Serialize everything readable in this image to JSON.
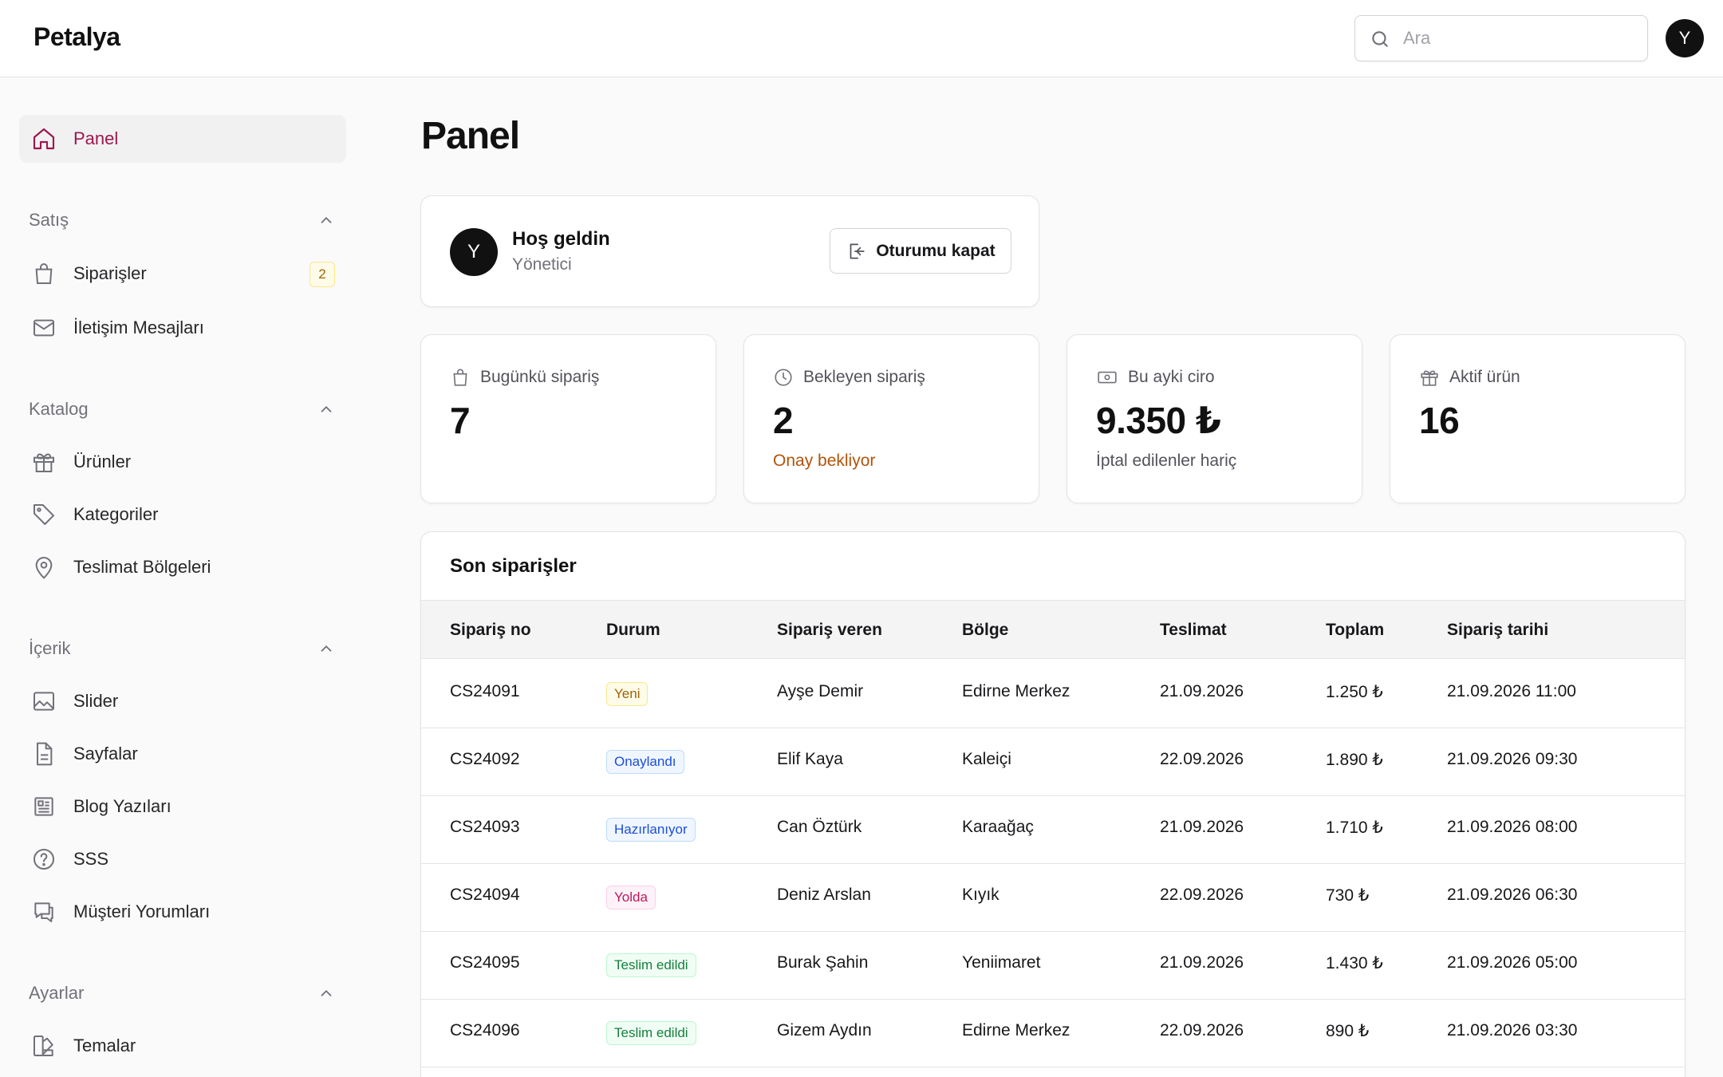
{
  "brand": "Petalya",
  "search": {
    "placeholder": "Ara",
    "value": ""
  },
  "user": {
    "initial": "Y"
  },
  "sidebar": {
    "panel": "Panel",
    "sections": [
      {
        "title": "Satış",
        "items": [
          {
            "label": "Siparişler",
            "icon": "shopping-bag-icon",
            "badge": "2"
          },
          {
            "label": "İletişim Mesajları",
            "icon": "mail-icon"
          }
        ]
      },
      {
        "title": "Katalog",
        "items": [
          {
            "label": "Ürünler",
            "icon": "gift-icon"
          },
          {
            "label": "Kategoriler",
            "icon": "tag-icon"
          },
          {
            "label": "Teslimat Bölgeleri",
            "icon": "map-pin-icon"
          }
        ]
      },
      {
        "title": "İçerik",
        "items": [
          {
            "label": "Slider",
            "icon": "image-icon"
          },
          {
            "label": "Sayfalar",
            "icon": "file-icon"
          },
          {
            "label": "Blog Yazıları",
            "icon": "newspaper-icon"
          },
          {
            "label": "SSS",
            "icon": "help-circle-icon"
          },
          {
            "label": "Müşteri Yorumları",
            "icon": "message-icon"
          }
        ]
      },
      {
        "title": "Ayarlar",
        "items": [
          {
            "label": "Temalar",
            "icon": "palette-icon"
          }
        ]
      }
    ]
  },
  "page_title": "Panel",
  "welcome": {
    "initial": "Y",
    "title": "Hoş geldin",
    "subtitle": "Yönetici",
    "logout": "Oturumu kapat"
  },
  "stats": [
    {
      "label": "Bugünkü sipariş",
      "value": "7",
      "note": "",
      "icon": "shopping-bag-icon"
    },
    {
      "label": "Bekleyen sipariş",
      "value": "2",
      "note": "Onay bekliyor",
      "note_color": "#b45309",
      "icon": "clock-icon"
    },
    {
      "label": "Bu ayki ciro",
      "value": "9.350 ₺",
      "note": "İptal edilenler hariç",
      "note_color": "#52525b",
      "icon": "banknote-icon"
    },
    {
      "label": "Aktif ürün",
      "value": "16",
      "note": "",
      "icon": "gift-icon"
    }
  ],
  "orders": {
    "title": "Son siparişler",
    "columns": [
      "Sipariş no",
      "Durum",
      "Sipariş veren",
      "Bölge",
      "Teslimat",
      "Toplam",
      "Sipariş tarihi"
    ],
    "rows": [
      [
        "CS24091",
        "Yeni",
        "Ayşe Demir",
        "Edirne Merkez",
        "21.09.2026",
        "1.250 ₺",
        "21.09.2026 11:00"
      ],
      [
        "CS24092",
        "Onaylandı",
        "Elif Kaya",
        "Kaleiçi",
        "22.09.2026",
        "1.890 ₺",
        "21.09.2026 09:30"
      ],
      [
        "CS24093",
        "Hazırlanıyor",
        "Can Öztürk",
        "Karaağaç",
        "21.09.2026",
        "1.710 ₺",
        "21.09.2026 08:00"
      ],
      [
        "CS24094",
        "Yolda",
        "Deniz Arslan",
        "Kıyık",
        "22.09.2026",
        "730 ₺",
        "21.09.2026 06:30"
      ],
      [
        "CS24095",
        "Teslim edildi",
        "Burak Şahin",
        "Yeniimaret",
        "21.09.2026",
        "1.430 ₺",
        "21.09.2026 05:00"
      ],
      [
        "CS24096",
        "Teslim edildi",
        "Gizem Aydın",
        "Edirne Merkez",
        "22.09.2026",
        "890 ₺",
        "21.09.2026 03:30"
      ]
    ]
  },
  "colors": {
    "accent": "#9d174d",
    "pending_note": "#b45309"
  }
}
